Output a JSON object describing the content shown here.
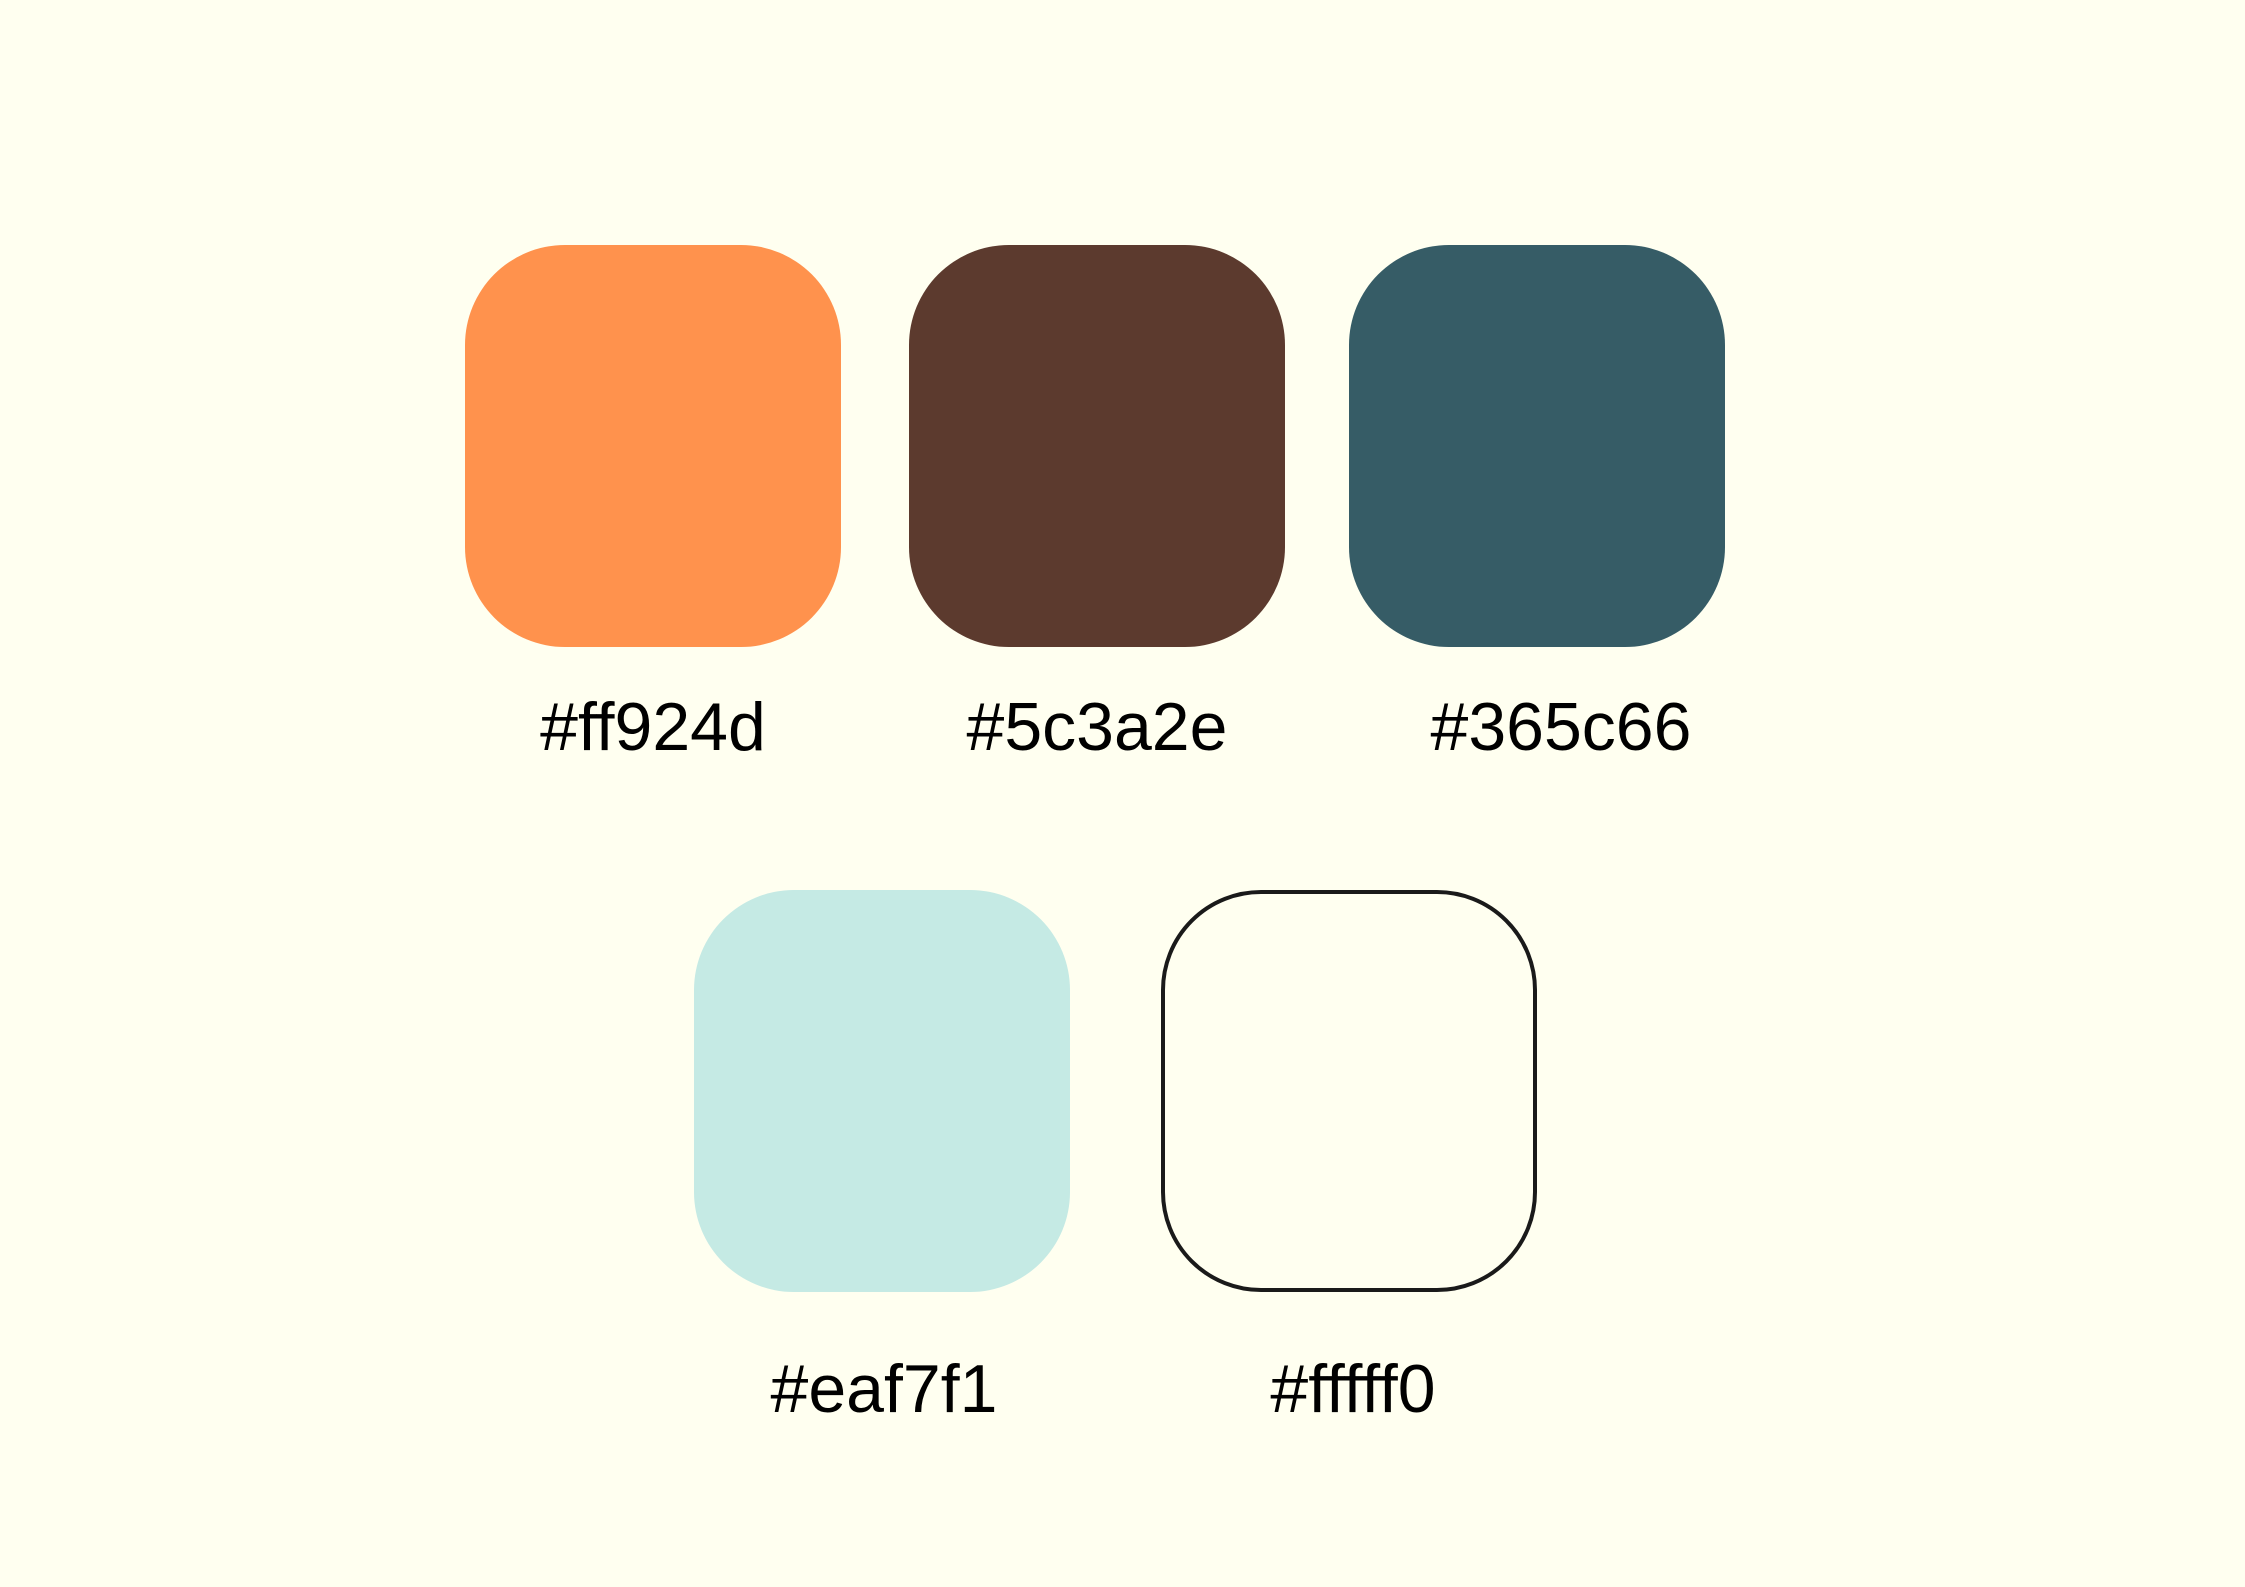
{
  "background_color": "#fffff0",
  "palette": [
    {
      "label": "#ff924d",
      "color": "#ff924d"
    },
    {
      "label": "#5c3a2e",
      "color": "#5c3a2e"
    },
    {
      "label": "#365c66",
      "color": "#365c66"
    },
    {
      "label": "#eaf7f1",
      "color": "#c5eae4"
    },
    {
      "label": "#fffff0",
      "color": "#fffff0"
    }
  ]
}
